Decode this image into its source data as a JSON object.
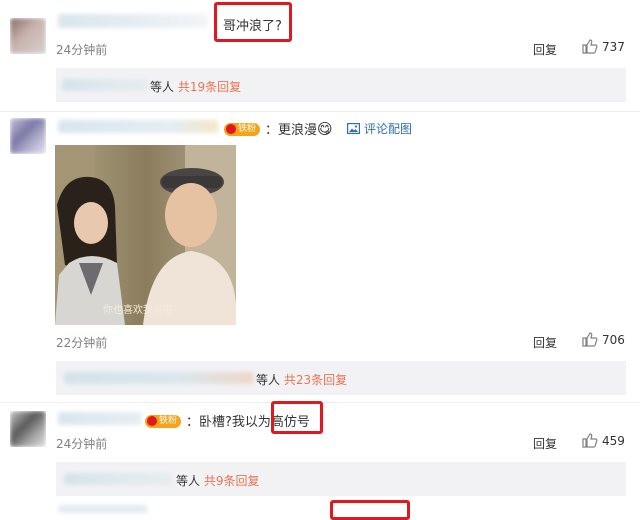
{
  "comments": [
    {
      "text": "哥冲浪了?",
      "time": "24分钟前",
      "reply_label": "回复",
      "likes": "737",
      "sub": {
        "prefix": "等人",
        "count": "共19条回复"
      }
    },
    {
      "badge": "铁粉",
      "text": "更浪漫",
      "emoji": "😋",
      "pic_link": "评论配图",
      "image_caption": "你也喜欢我对吧",
      "time": "22分钟前",
      "reply_label": "回复",
      "likes": "706",
      "sub": {
        "prefix": "等人",
        "count": "共23条回复"
      }
    },
    {
      "badge": "铁粉",
      "text_before": "卧槽?我以为",
      "text_boxed": "高仿号",
      "time": "24分钟前",
      "reply_label": "回复",
      "likes": "459",
      "sub": {
        "prefix": "等人",
        "count": "共9条回复"
      }
    }
  ],
  "colors": {
    "highlight": "#e0191e",
    "link": "#2d6fb3",
    "reply_count": "#eb7350",
    "fan": "#f6a31a"
  },
  "icons": [
    "thumb-up-icon",
    "picture-icon",
    "vip-crown-icon"
  ]
}
